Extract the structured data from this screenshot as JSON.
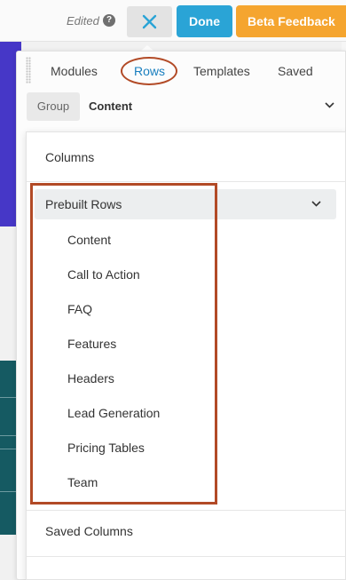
{
  "toolbar": {
    "edited_label": "Edited",
    "help_glyph": "?",
    "done_label": "Done",
    "beta_label": "Beta Feedback",
    "colors": {
      "done": "#2aa4d6",
      "beta": "#f5a52f",
      "annotation": "#b24a26"
    }
  },
  "panel": {
    "tabs": [
      {
        "label": "Modules",
        "active": false
      },
      {
        "label": "Rows",
        "active": true
      },
      {
        "label": "Templates",
        "active": false
      },
      {
        "label": "Saved",
        "active": false
      }
    ],
    "group": {
      "label": "Group",
      "value": "Content"
    }
  },
  "dropdown": {
    "columns_label": "Columns",
    "prebuilt": {
      "label": "Prebuilt Rows",
      "items": [
        "Content",
        "Call to Action",
        "FAQ",
        "Features",
        "Headers",
        "Lead Generation",
        "Pricing Tables",
        "Team"
      ]
    },
    "saved_columns_label": "Saved Columns"
  }
}
